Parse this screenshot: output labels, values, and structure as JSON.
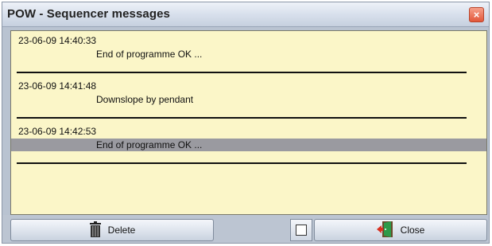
{
  "window": {
    "title": "POW - Sequencer messages"
  },
  "messages": [
    {
      "timestamp": "23-06-09 14:40:33",
      "text": "End of programme OK ...",
      "selected": false
    },
    {
      "timestamp": "23-06-09 14:41:48",
      "text": "Downslope by pendant",
      "selected": false
    },
    {
      "timestamp": "23-06-09 14:42:53",
      "text": "End of programme OK ...",
      "selected": true
    }
  ],
  "footer": {
    "delete_label": "Delete",
    "close_label": "Close",
    "checkbox_checked": false
  },
  "icons": {
    "delete": "trash-icon",
    "close": "exit-door-icon",
    "window_close": "close-icon"
  },
  "colors": {
    "list_background": "#fbf6c8",
    "selection": "#9a9aa0",
    "close_button": "#e2573a"
  }
}
